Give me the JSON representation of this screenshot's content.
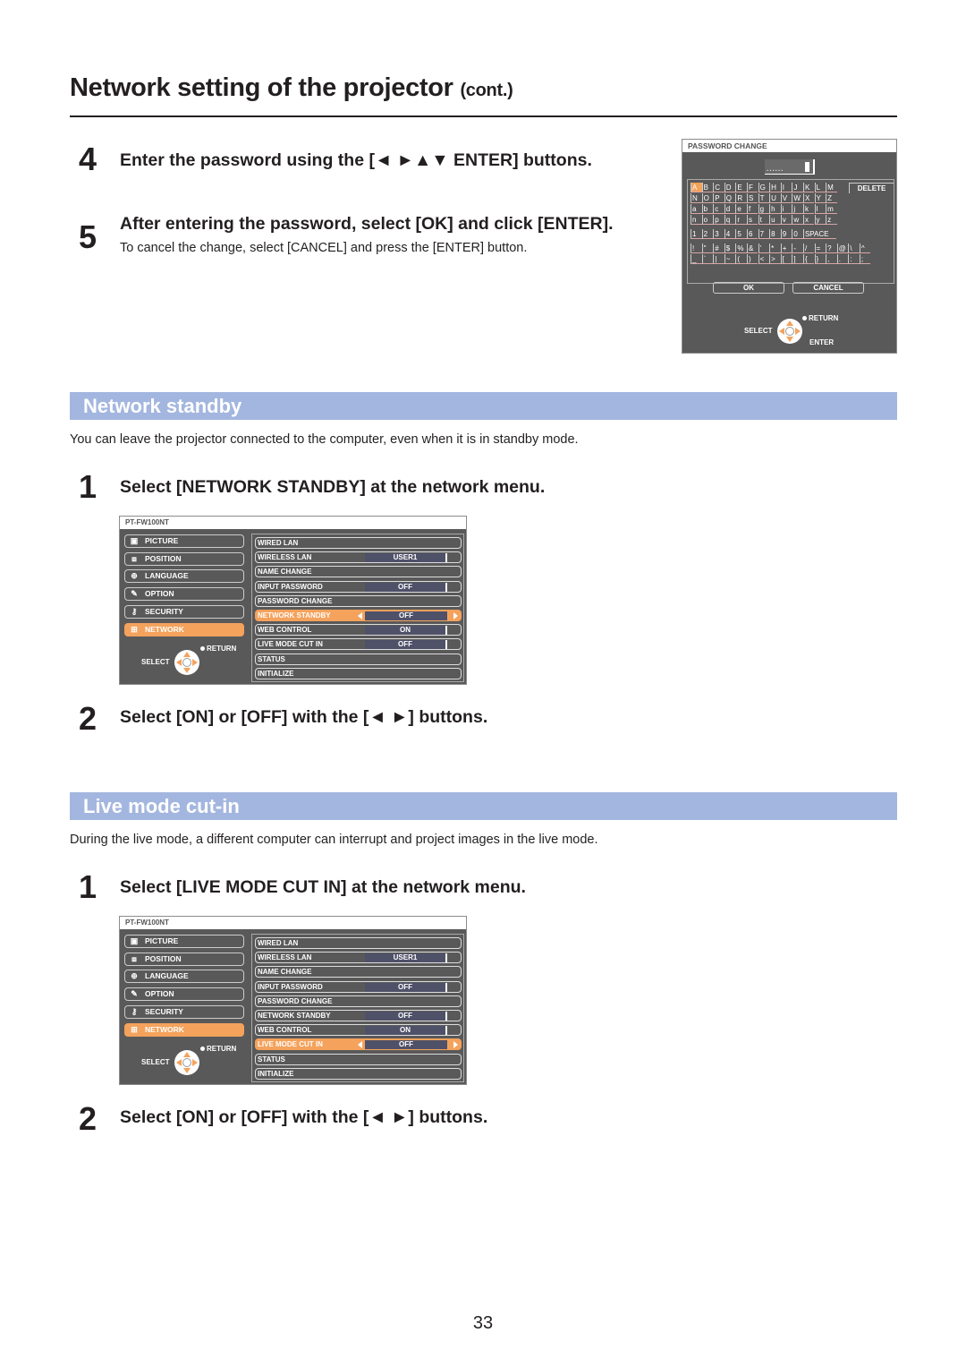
{
  "page": {
    "title": "Network setting of the projector",
    "title_suffix": "(cont.)",
    "page_number": "33"
  },
  "password_steps": [
    {
      "num": "4",
      "heading": "Enter the password using the [◄ ►▲▼ ENTER] buttons."
    },
    {
      "num": "5",
      "heading": "After entering the password, select [OK] and click [ENTER].",
      "note": "To cancel the change, select [CANCEL] and press the [ENTER] button."
    }
  ],
  "password_osd": {
    "title": "PASSWORD CHANGE",
    "masked": "......",
    "rows": [
      [
        "A",
        "B",
        "C",
        "D",
        "E",
        "F",
        "G",
        "H",
        "I",
        "J",
        "K",
        "L",
        "M"
      ],
      [
        "N",
        "O",
        "P",
        "Q",
        "R",
        "S",
        "T",
        "U",
        "V",
        "W",
        "X",
        "Y",
        "Z"
      ],
      [
        "a",
        "b",
        "c",
        "d",
        "e",
        "f",
        "g",
        "h",
        "i",
        "j",
        "k",
        "l",
        "m"
      ],
      [
        "n",
        "o",
        "p",
        "q",
        "r",
        "s",
        "t",
        "u",
        "v",
        "w",
        "x",
        "y",
        "z"
      ],
      [
        "1",
        "2",
        "3",
        "4",
        "5",
        "6",
        "7",
        "8",
        "9",
        "0"
      ],
      [
        "!",
        "\"",
        "#",
        "$",
        "%",
        "&",
        "'",
        "*",
        "+",
        "-",
        "/",
        "=",
        "?",
        "@",
        "\\",
        "^"
      ],
      [
        "_",
        "`",
        "|",
        "~",
        "(",
        ")",
        "<",
        ">",
        "[",
        "]",
        "{",
        "}",
        ",",
        ".",
        ":",
        ";"
      ]
    ],
    "selected_key": "A",
    "delete_label": "DELETE",
    "space_label": "SPACE",
    "ok_label": "OK",
    "cancel_label": "CANCEL",
    "select_label": "SELECT",
    "return_label": "RETURN",
    "enter_label": "ENTER"
  },
  "network_standby": {
    "section_title": "Network standby",
    "description": "You can leave the projector connected to the computer, even when it is in standby mode.",
    "step1": {
      "num": "1",
      "heading": "Select [NETWORK STANDBY] at the network menu."
    },
    "step2": {
      "num": "2",
      "heading": "Select [ON] or [OFF] with the [◄ ►] buttons."
    }
  },
  "live_mode": {
    "section_title": "Live mode cut-in",
    "description": "During the live mode, a different computer can interrupt and project images in the live mode.",
    "step1": {
      "num": "1",
      "heading": "Select [LIVE MODE CUT IN] at the network menu."
    },
    "step2": {
      "num": "2",
      "heading": "Select [ON] or [OFF] with the [◄ ►] buttons."
    }
  },
  "network_menu": {
    "title": "PT-FW100NT",
    "left_items": [
      {
        "label": "PICTURE",
        "icon": "picture-icon"
      },
      {
        "label": "POSITION",
        "icon": "position-icon"
      },
      {
        "label": "LANGUAGE",
        "icon": "globe-icon"
      },
      {
        "label": "OPTION",
        "icon": "option-icon"
      },
      {
        "label": "SECURITY",
        "icon": "key-icon"
      },
      {
        "label": "NETWORK",
        "icon": "network-icon"
      }
    ],
    "selected_left": "NETWORK",
    "right_items": [
      {
        "label": "WIRED LAN",
        "value": null
      },
      {
        "label": "WIRELESS LAN",
        "value": "USER1"
      },
      {
        "label": "NAME CHANGE",
        "value": null
      },
      {
        "label": "INPUT PASSWORD",
        "value": "OFF"
      },
      {
        "label": "PASSWORD CHANGE",
        "value": null
      },
      {
        "label": "NETWORK STANDBY",
        "value": "OFF"
      },
      {
        "label": "WEB CONTROL",
        "value": "ON"
      },
      {
        "label": "LIVE MODE CUT IN",
        "value": "OFF"
      },
      {
        "label": "STATUS",
        "value": null
      },
      {
        "label": "INITIALIZE",
        "value": null
      }
    ],
    "select_label": "SELECT",
    "return_label": "RETURN"
  },
  "menus": [
    {
      "highlight": "NETWORK STANDBY"
    },
    {
      "highlight": "LIVE MODE CUT IN"
    }
  ],
  "colors": {
    "section_bar": "#a3b6df",
    "highlight": "#f4a25c",
    "osd_bg": "#595959",
    "value_bg": "#4f5169"
  }
}
